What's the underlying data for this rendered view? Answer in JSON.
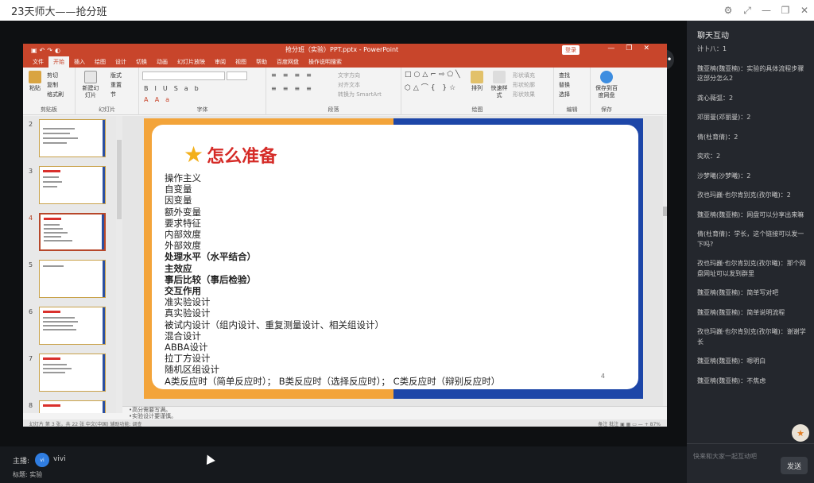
{
  "window": {
    "title": "23天师大——抢分班",
    "controls": [
      "⚙",
      "⤢",
      "—",
      "❐",
      "✕"
    ]
  },
  "stage_icons": [
    "⇄",
    "⇧",
    "•••"
  ],
  "powerpoint": {
    "file_title": "抢分班（实验）PPT.pptx  -  PowerPoint",
    "login": "登录",
    "tabs": [
      "文件",
      "开始",
      "插入",
      "绘图",
      "设计",
      "切换",
      "动画",
      "幻灯片放映",
      "审阅",
      "视图",
      "帮助",
      "百度网盘",
      "操作说明搜索"
    ],
    "active_tab": "开始",
    "ribbon": {
      "clipboard": {
        "paste": "粘贴",
        "cut": "剪切",
        "copy": "复制",
        "format": "格式刷",
        "label": "剪贴板"
      },
      "slides": {
        "new": "新建幻灯片",
        "layout": "版式",
        "reset": "重置",
        "section": "节",
        "label": "幻灯片"
      },
      "font": {
        "label": "字体"
      },
      "paragraph": {
        "text_dir": "文字方向",
        "align": "对齐文本",
        "smartart": "转换为 SmartArt",
        "label": "段落"
      },
      "drawing": {
        "arrange": "排列",
        "quick": "快速样式",
        "fill": "形状填充",
        "outline": "形状轮廓",
        "effect": "形状效果",
        "label": "绘图"
      },
      "editing": {
        "find": "查找",
        "replace": "替换",
        "select": "选择",
        "label": "编辑"
      },
      "save": {
        "save": "保存到百度网盘",
        "label": "保存"
      }
    },
    "thumbnails": [
      {
        "num": "2"
      },
      {
        "num": "3"
      },
      {
        "num": "4"
      },
      {
        "num": "5"
      },
      {
        "num": "6"
      },
      {
        "num": "7"
      },
      {
        "num": "8"
      }
    ],
    "active_thumbnail": "4",
    "slide": {
      "title": "怎么准备",
      "lines": [
        {
          "t": "操作主义",
          "b": false
        },
        {
          "t": "自变量",
          "b": false
        },
        {
          "t": "因变量",
          "b": false
        },
        {
          "t": "额外变量",
          "b": false
        },
        {
          "t": "要求特征",
          "b": false
        },
        {
          "t": "内部效度",
          "b": false
        },
        {
          "t": "外部效度",
          "b": false
        },
        {
          "t": "处理水平（水平结合）",
          "b": true
        },
        {
          "t": "主效应",
          "b": true
        },
        {
          "t": "事后比较（事后检验）",
          "b": true
        },
        {
          "t": "交互作用",
          "b": true
        },
        {
          "t": "准实验设计",
          "b": false
        },
        {
          "t": "真实验设计",
          "b": false
        },
        {
          "t": "被试内设计（组内设计、重复测量设计、相关组设计）",
          "b": false
        },
        {
          "t": "混合设计",
          "b": false
        },
        {
          "t": "ABBA设计",
          "b": false
        },
        {
          "t": "拉丁方设计",
          "b": false
        },
        {
          "t": "随机区组设计",
          "b": false
        },
        {
          "t": "A类反应时（简单反应时）；  B类反应时（选择反应时）；  C类反应时（辩别反应时）",
          "b": false
        }
      ],
      "page_num": "4"
    },
    "notes": [
      "•高分需要写满。",
      "•实验设计要谨慎。"
    ],
    "status_left": "幻灯片 第 3 张，共 22 张    中文(中国)    辅助功能: 调查",
    "status_right": "备注    批注    ▣ ▦ ▭    —  +  87%"
  },
  "bottom": {
    "host_label": "主播:",
    "avatar_text": "vi",
    "host_name": "vivi",
    "topic": "标题:  实验"
  },
  "chat": {
    "header": "聊天互动",
    "messages": [
      "计卜八：1",
      "魏亚楠(魏亚楠)：实验的具体流程步骤这部分怎么2",
      "龚心薇弧：2",
      "邓丽曼(邓丽曼)：2",
      "倩(杜育倩)：2",
      "奕欢：2",
      "沙梦曦(沙梦曦)：2",
      "孜也玛巍·也尔肯别克(孜尔曦)：2",
      "魏亚楠(魏亚楠)：网盘可以分享出来嘛",
      "倩(杜育倩)：学长，这个链接可以发一下吗?",
      "孜也玛巍·也尔肯别克(孜尔曦)：那个网盘网址可以发到群里",
      "魏亚楠(魏亚楠)：简单写对吧",
      "魏亚楠(魏亚楠)：简单说明流程",
      "孜也玛巍·也尔肯别克(孜尔曦)：谢谢学长",
      "魏亚楠(魏亚楠)：嗯明白",
      "魏亚楠(魏亚楠)：不焦虑"
    ],
    "float_icon": "★",
    "input_placeholder": "快来和大家一起互动吧",
    "send_label": "发送"
  }
}
